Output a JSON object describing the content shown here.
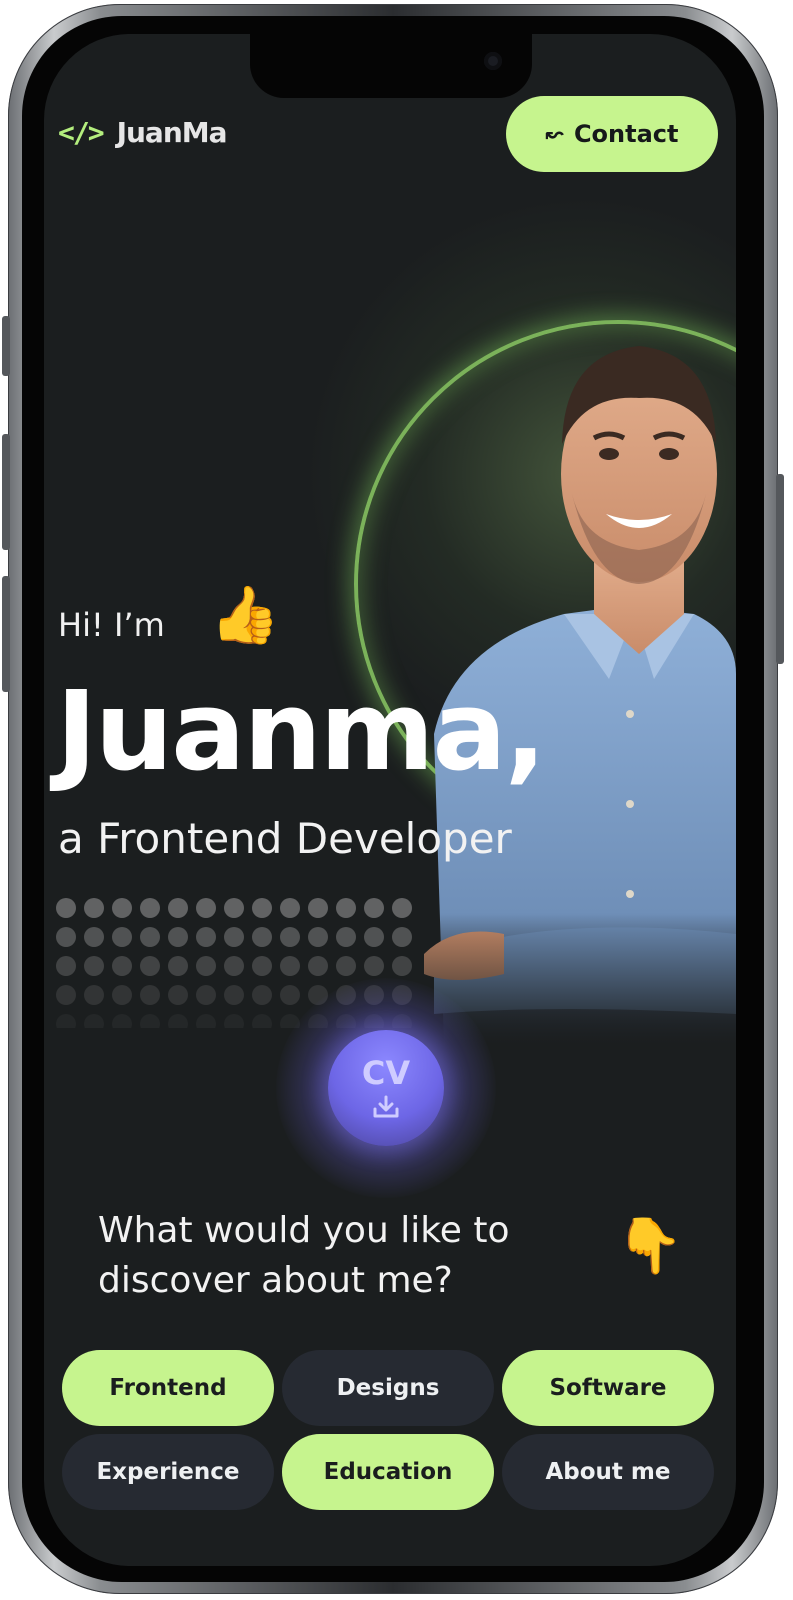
{
  "header": {
    "logo_code": "</>",
    "logo_name": "JuanMa",
    "contact_icon": "↜",
    "contact_label": "Contact"
  },
  "hero": {
    "greeting": "Hi! I’m",
    "greeting_emoji": "👍",
    "name": "Juanma,",
    "role": "a Frontend Developer"
  },
  "cv": {
    "label": "CV",
    "icon": "download-icon"
  },
  "discover": {
    "question": "What would you like to discover about me?",
    "emoji": "👇"
  },
  "categories": [
    {
      "label": "Frontend",
      "active": true
    },
    {
      "label": "Designs",
      "active": false
    },
    {
      "label": "Software",
      "active": true
    },
    {
      "label": "Experience",
      "active": false
    },
    {
      "label": "Education",
      "active": true
    },
    {
      "label": "About me",
      "active": false
    }
  ],
  "colors": {
    "accent": "#c6f48e",
    "background": "#1b1e1f",
    "chip_dark": "#262a32",
    "cv_purple": "#6d66e6",
    "ring_green": "#7bb25a"
  }
}
